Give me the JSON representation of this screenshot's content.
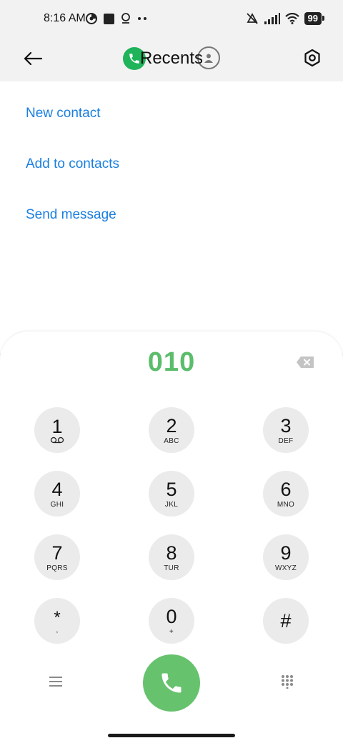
{
  "status_bar": {
    "time": "8:16 AM",
    "battery": "99",
    "icons": [
      "chrome-icon",
      "square-icon",
      "location-icon",
      "more-dots-icon",
      "mute-icon",
      "signal-icon",
      "wifi-icon"
    ]
  },
  "header": {
    "title": "Recents",
    "icons": [
      "back-arrow-icon",
      "phone-icon",
      "contact-icon",
      "settings-icon"
    ]
  },
  "actions": [
    {
      "label": "New contact"
    },
    {
      "label": "Add to contacts"
    },
    {
      "label": "Send message"
    }
  ],
  "dialer": {
    "number": "010",
    "keys": [
      {
        "digit": "1",
        "letters": ""
      },
      {
        "digit": "2",
        "letters": "ABC"
      },
      {
        "digit": "3",
        "letters": "DEF"
      },
      {
        "digit": "4",
        "letters": "GHI"
      },
      {
        "digit": "5",
        "letters": "JKL"
      },
      {
        "digit": "6",
        "letters": "MNO"
      },
      {
        "digit": "7",
        "letters": "PQRS"
      },
      {
        "digit": "8",
        "letters": "TUR"
      },
      {
        "digit": "9",
        "letters": "WXYZ"
      },
      {
        "digit": "*",
        "letters": ","
      },
      {
        "digit": "0",
        "letters": "+"
      },
      {
        "digit": "#",
        "letters": ""
      }
    ]
  },
  "colors": {
    "accent_blue": "#1a7fe0",
    "dial_number_green": "#5bbd6c",
    "call_button_green": "#66c26d",
    "phone_badge_green": "#1fb35a",
    "key_background": "#ebebeb"
  }
}
